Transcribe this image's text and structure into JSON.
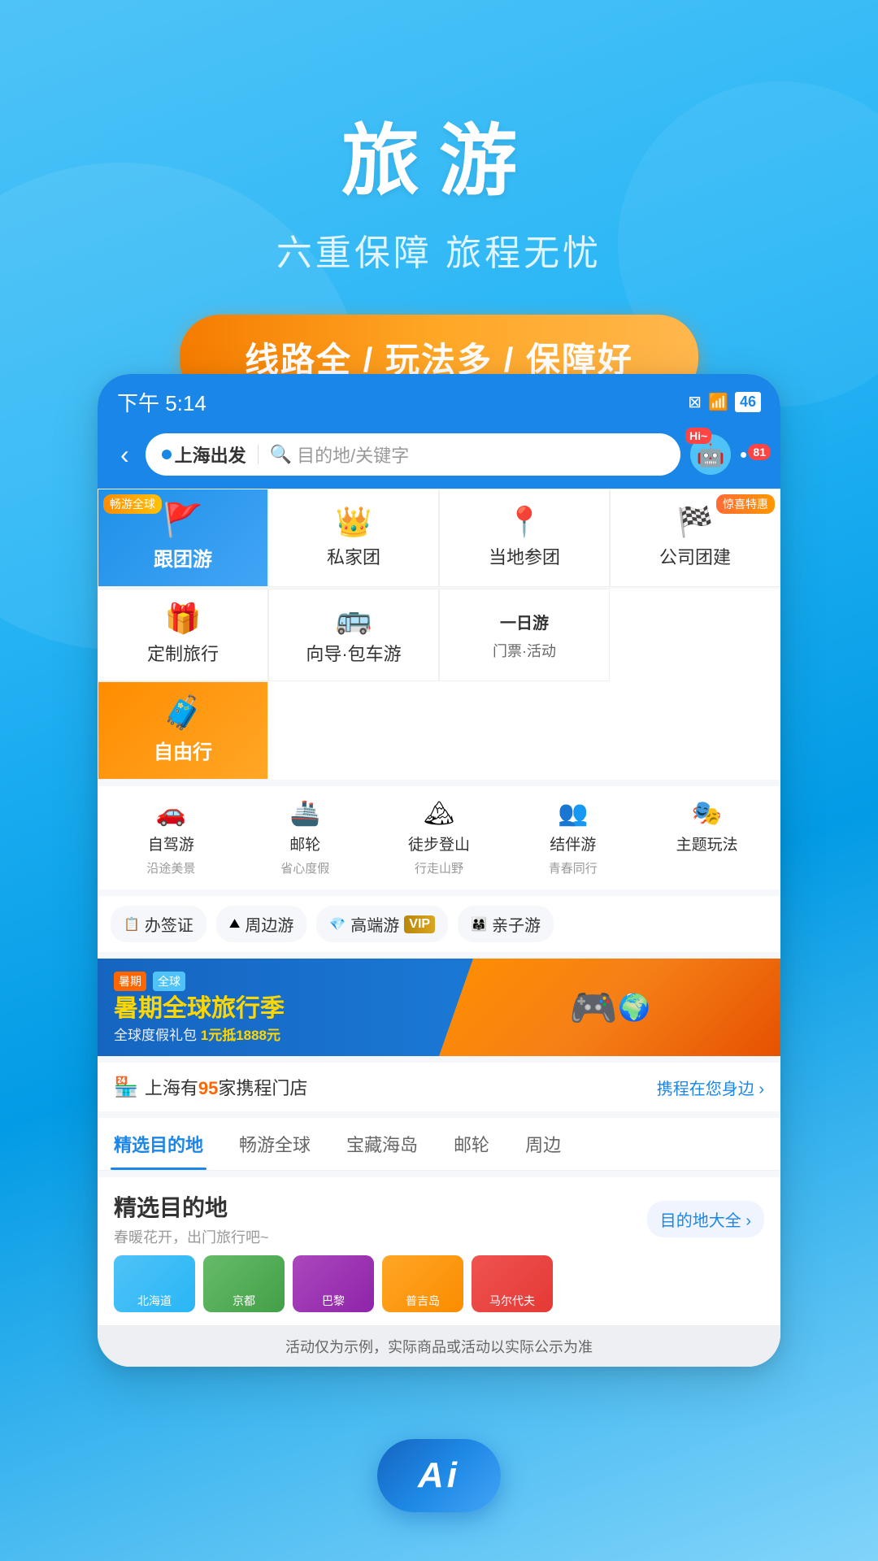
{
  "app": {
    "title": "旅游",
    "subtitle": "六重保障 旅程无忧",
    "promo_banner_text": "线路全 / 玩法多 / 保障好"
  },
  "status_bar": {
    "time": "下午 5:14",
    "battery": "46"
  },
  "nav": {
    "back_label": "‹",
    "origin": "上海出发",
    "dest_placeholder": "目的地/关键字",
    "hi_badge": "Hi~",
    "notification_count": "81"
  },
  "categories": {
    "row1": [
      {
        "id": "group_tour",
        "label": "跟团游",
        "badge": "畅游全球",
        "icon": "🚩",
        "featured": true,
        "color": "blue"
      },
      {
        "id": "private_tour",
        "label": "私家团",
        "icon": "👑",
        "featured": false
      },
      {
        "id": "local_tour",
        "label": "当地参团",
        "icon": "📍",
        "featured": false
      },
      {
        "id": "corp_tour",
        "label": "公司团建",
        "badge_right": "惊喜特惠",
        "icon": "🏁",
        "featured": false
      }
    ],
    "row2": [
      {
        "id": "free_travel",
        "label": "自由行",
        "icon": "🧳",
        "featured": true,
        "color": "orange"
      },
      {
        "id": "custom_travel",
        "label": "定制旅行",
        "icon": "🧧",
        "featured": false
      },
      {
        "id": "guide_tour",
        "label": "向导·包车游",
        "icon": "💋",
        "featured": false
      },
      {
        "id": "day_tour_tickets",
        "label": "一日游\n门票·活动",
        "icon": "",
        "featured": false,
        "dual_label": true,
        "label1": "一日游",
        "label2": "门票·活动"
      }
    ]
  },
  "small_cats": [
    {
      "id": "self_drive",
      "label": "自驾游",
      "sublabel": "沿途美景",
      "icon": "🚗"
    },
    {
      "id": "cruise",
      "label": "邮轮",
      "sublabel": "省心度假",
      "icon": "🚢"
    },
    {
      "id": "hiking",
      "label": "徒步登山",
      "sublabel": "行走山野",
      "icon": "🏔"
    },
    {
      "id": "companion",
      "label": "结伴游",
      "sublabel": "青春同行",
      "icon": "👥"
    },
    {
      "id": "theme",
      "label": "主题玩法",
      "sublabel": "",
      "icon": "🎭"
    }
  ],
  "service_tags": [
    {
      "id": "visa",
      "label": "办签证",
      "icon": "📋"
    },
    {
      "id": "nearby",
      "label": "周边游",
      "icon": "⛰"
    },
    {
      "id": "luxury",
      "label": "高端游",
      "vip": true,
      "icon": "💎"
    },
    {
      "id": "family",
      "label": "亲子游",
      "icon": "👨‍👩‍👧"
    }
  ],
  "promo": {
    "text1": "暑期全球旅行季",
    "text2": "全球度假礼包",
    "discount": "1元抵1888元"
  },
  "store": {
    "city": "上海",
    "count": "95",
    "unit": "家携程门店",
    "link_text": "携程在您身边 ›"
  },
  "tabs": [
    {
      "id": "selected_dest",
      "label": "精选目的地",
      "active": true
    },
    {
      "id": "global",
      "label": "畅游全球",
      "active": false
    },
    {
      "id": "island",
      "label": "宝藏海岛",
      "active": false
    },
    {
      "id": "cruise_tab",
      "label": "邮轮",
      "active": false
    },
    {
      "id": "nearby_tab",
      "label": "周边",
      "active": false
    }
  ],
  "destination": {
    "section_title": "精选目的地",
    "section_subtitle": "春暖花开，出门旅行吧~",
    "more_button": "目的地大全 ›",
    "items": [
      {
        "name": "北海道",
        "color": "blue"
      },
      {
        "name": "京都",
        "color": "green"
      },
      {
        "name": "巴黎",
        "color": "purple"
      },
      {
        "name": "普吉岛",
        "color": "orange"
      }
    ]
  },
  "disclaimer": "活动仅为示例，实际商品或活动以实际公示为准",
  "ai_button": {
    "label": "Ai"
  }
}
